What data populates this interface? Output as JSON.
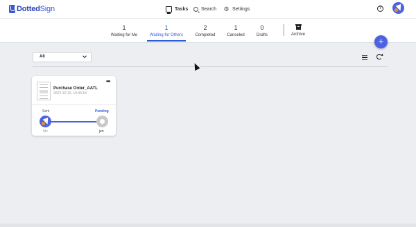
{
  "app": {
    "logo_text_bold": "Dotted",
    "logo_text": "Sign"
  },
  "nav": {
    "tasks": "Tasks",
    "search": "Search",
    "settings": "Settings"
  },
  "help_glyph": "?",
  "tabs": [
    {
      "count": "1",
      "label": "Waiting for Me",
      "active": false
    },
    {
      "count": "1",
      "label": "Waiting for Others",
      "active": true
    },
    {
      "count": "2",
      "label": "Completed",
      "active": false
    },
    {
      "count": "1",
      "label": "Canceled",
      "active": false
    },
    {
      "count": "0",
      "label": "Drafts",
      "active": false
    }
  ],
  "archive_label": "Archive",
  "fab_glyph": "+",
  "filter": {
    "selected": "All"
  },
  "cards": [
    {
      "title": "Purchase Order_AATL",
      "date": "2022-10-19, 10:44:18",
      "more": "•••",
      "status_left": "Sent",
      "status_right": "Pending",
      "signer_left": "Me",
      "signer_right": "jen"
    }
  ],
  "colors": {
    "accent": "#2c5bd8",
    "brand": "#4c63e0",
    "background": "#eceef1",
    "avatar_dot": "#f08a2a"
  },
  "icons": [
    "tasks-icon",
    "search-icon",
    "gear-icon",
    "help-icon",
    "archive-icon",
    "list-view-icon",
    "refresh-icon",
    "more-icon",
    "chevron-down-icon"
  ]
}
